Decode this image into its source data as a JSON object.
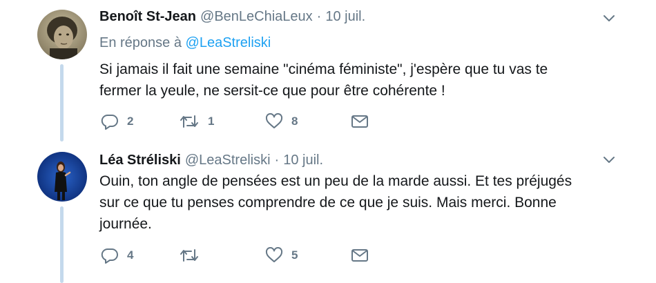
{
  "tweets": [
    {
      "name": "Benoît St-Jean",
      "handle": "@BenLeChiaLeux",
      "separator": "·",
      "date": "10 juil.",
      "reply_prefix": "En réponse à",
      "reply_to": "@LeaStreliski",
      "text_lines": [
        "Si jamais il fait une semaine \"cinéma féministe\", j'espère que tu vas te",
        "fermer la yeule, ne sersit-ce que pour être cohérente !"
      ],
      "reply_count": "2",
      "retweet_count": "1",
      "like_count": "8",
      "avatar_icon": "sepia-portrait-avatar"
    },
    {
      "name": "Léa Stréliski",
      "handle": "@LeaStreliski",
      "separator": "·",
      "date": "10 juil.",
      "text_lines": [
        "Ouin, ton angle de pensées est un peu de la marde aussi. Et tes préjugés",
        "sur ce que tu penses comprendre de ce que je suis. Mais merci. Bonne",
        "journée."
      ],
      "reply_count": "4",
      "retweet_count": "",
      "like_count": "5",
      "avatar_icon": "stage-performer-avatar"
    }
  ],
  "colors": {
    "accent": "#1da1f2",
    "muted": "#657786",
    "thread_line": "#c4d9ec",
    "text": "#14171a"
  },
  "icons": {
    "reply": "reply-icon",
    "retweet": "retweet-icon",
    "like": "heart-icon",
    "dm": "envelope-icon",
    "more": "chevron-down-icon"
  }
}
